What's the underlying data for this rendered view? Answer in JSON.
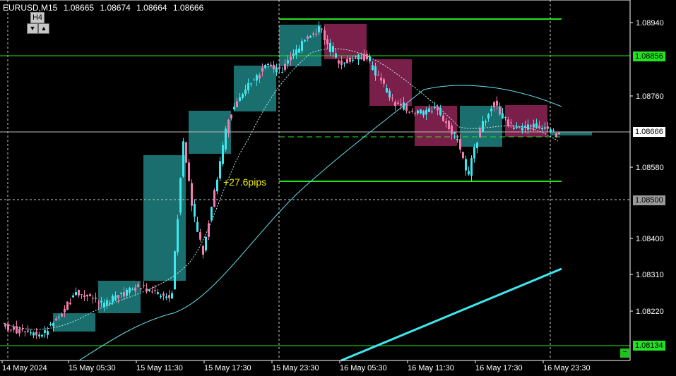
{
  "header": {
    "symbol": "EURUSD,M15",
    "open": "1.08665",
    "high": "1.08674",
    "low": "1.08664",
    "close": "1.08666"
  },
  "overlay": {
    "timeframe_label": "H4",
    "down_btn": "▼",
    "up_btn": "▲"
  },
  "annotation": {
    "pips_text": "+27.6pips"
  },
  "price_axis": {
    "ticks": [
      "1.08940",
      "1.08760",
      "1.08580",
      "1.08400",
      "1.08310",
      "1.08220"
    ],
    "tags": [
      {
        "label": "1.08856",
        "style": "green"
      },
      {
        "label": "1.08666",
        "style": "current"
      },
      {
        "label": "1.08500",
        "style": "gray"
      },
      {
        "label": "1.08134",
        "style": "green"
      }
    ]
  },
  "time_axis": {
    "labels": [
      "14 May 2024",
      "15 May 05:30",
      "15 May 11:30",
      "15 May 17:30",
      "15 May 23:30",
      "16 May 05:30",
      "16 May 11:30",
      "16 May 17:30",
      "16 May 23:30"
    ]
  },
  "colors": {
    "bull": "#3ee8ee",
    "bear": "#f27cae",
    "h4_bull": "#1a6e6e",
    "h4_bear": "#7a1f4a",
    "level": "#22e322",
    "ma": "#62e0ea",
    "background": "#000000"
  },
  "corner_button": "−"
}
